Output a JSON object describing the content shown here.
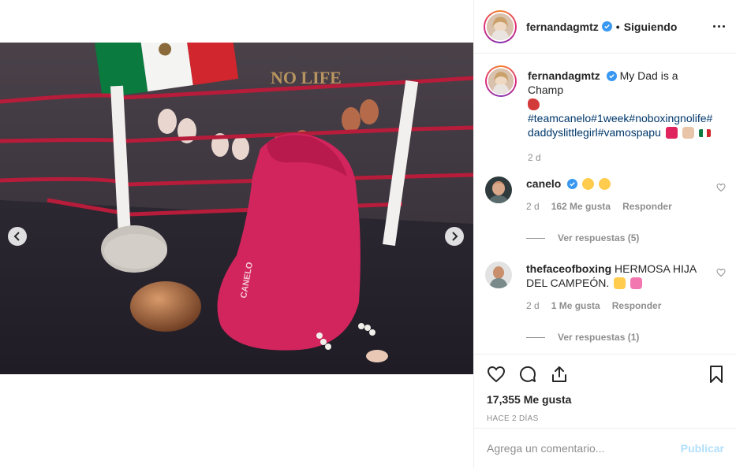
{
  "post": {
    "author": "fernandagmtz",
    "follow_separator": "•",
    "follow_status": "Siguiendo",
    "caption_text": "My Dad is a Champ",
    "caption_hashtags": "#teamcanelo#1week#noboxingnolife#daddyslittlegirl#vamospapu",
    "caption_time": "2 d",
    "likes": "17,355 Me gusta",
    "time_ago": "HACE 2 DÍAS",
    "photo_sign_text": "NO LIFE",
    "photo_hoodie_text": "CANELO"
  },
  "comments": [
    {
      "user": "canelo",
      "text": "",
      "time": "2 d",
      "likes": "162 Me gusta",
      "reply_label": "Responder",
      "view_replies": "Ver respuestas (5)"
    },
    {
      "user": "thefaceofboxing",
      "text": "HERMOSA HIJA DEL CAMPEÓN.",
      "time": "2 d",
      "likes": "1 Me gusta",
      "reply_label": "Responder",
      "view_replies": "Ver respuestas (1)"
    }
  ],
  "add_comment": {
    "placeholder": "Agrega un comentario...",
    "publish_label": "Publicar"
  },
  "icons": {
    "like": "heart-icon",
    "comment": "comment-icon",
    "share": "share-icon",
    "save": "bookmark-icon",
    "more": "more-options-icon",
    "verified": "verified-badge-icon",
    "prev": "chevron-left-icon",
    "next": "chevron-right-icon"
  },
  "colors": {
    "link": "#00376b",
    "muted": "#8e8e8e",
    "verified": "#3897f0",
    "publish_disabled": "#b2dffc",
    "hoodie": "#d2245d",
    "ropes": "#b71c3a"
  }
}
